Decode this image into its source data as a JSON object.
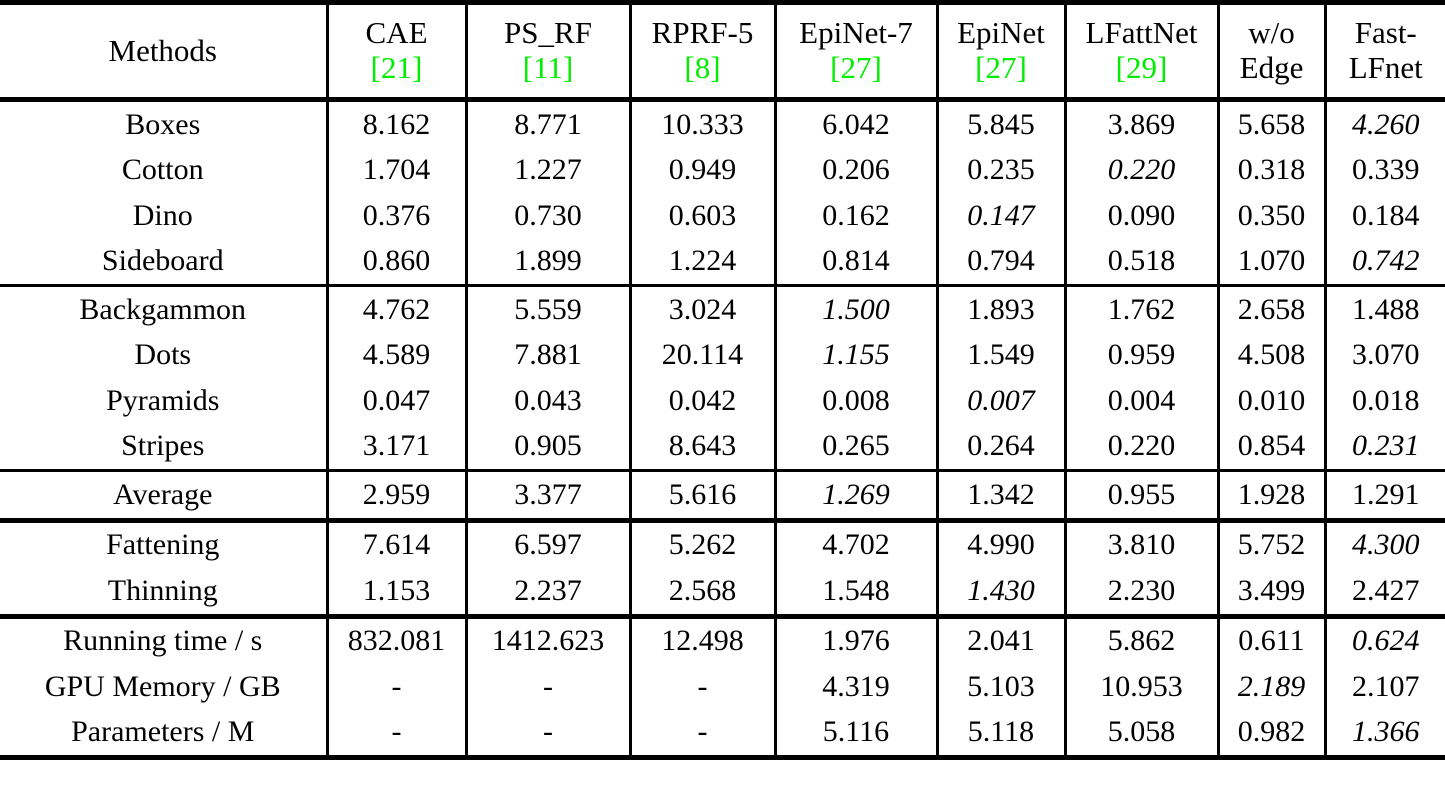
{
  "table": {
    "columns": [
      {
        "name": "Methods",
        "ref": "",
        "key": "methods"
      },
      {
        "name": "CAE",
        "ref": "21",
        "key": "cae"
      },
      {
        "name": "PS_RF",
        "ref": "11",
        "key": "psrf"
      },
      {
        "name": "RPRF-5",
        "ref": "8",
        "key": "rprf"
      },
      {
        "name": "EpiNet-7",
        "ref": "27",
        "key": "epi7"
      },
      {
        "name": "EpiNet",
        "ref": "27",
        "key": "epi"
      },
      {
        "name": "LFattNet",
        "ref": "29",
        "key": "lfatt"
      },
      {
        "name": "w/o Edge",
        "ref": "",
        "key": "woedge"
      },
      {
        "name": "Fast-LFnet",
        "ref": "",
        "key": "fast"
      }
    ],
    "header": {
      "methods": "Methods",
      "cae_name": "CAE",
      "cae_ref": "[21]",
      "psrf_name": "PS_RF",
      "psrf_ref": "[11]",
      "rprf_name": "RPRF-5",
      "rprf_ref": "[8]",
      "epi7_name": "EpiNet-7",
      "epi7_ref": "[27]",
      "epi_name": "EpiNet",
      "epi_ref": "[27]",
      "lfatt_name": "LFattNet",
      "lfatt_ref": "[29]",
      "woedge_name": "w/o",
      "woedge_ref": "Edge",
      "fast_name": "Fast-",
      "fast_ref": "LFnet"
    },
    "ref_color": "#00ee00",
    "rows": [
      {
        "label": "Boxes",
        "cae": "8.162",
        "psrf": "8.771",
        "rprf": "10.333",
        "epi7": "6.042",
        "epi": "5.845",
        "lfatt": "3.869",
        "woedge": "5.658",
        "fast": "4.260"
      },
      {
        "label": "Cotton",
        "cae": "1.704",
        "psrf": "1.227",
        "rprf": "0.949",
        "epi7": "0.206",
        "epi": "0.235",
        "lfatt": "0.220",
        "woedge": "0.318",
        "fast": "0.339"
      },
      {
        "label": "Dino",
        "cae": "0.376",
        "psrf": "0.730",
        "rprf": "0.603",
        "epi7": "0.162",
        "epi": "0.147",
        "lfatt": "0.090",
        "woedge": "0.350",
        "fast": "0.184"
      },
      {
        "label": "Sideboard",
        "cae": "0.860",
        "psrf": "1.899",
        "rprf": "1.224",
        "epi7": "0.814",
        "epi": "0.794",
        "lfatt": "0.518",
        "woedge": "1.070",
        "fast": "0.742"
      },
      {
        "label": "Backgammon",
        "cae": "4.762",
        "psrf": "5.559",
        "rprf": "3.024",
        "epi7": "1.500",
        "epi": "1.893",
        "lfatt": "1.762",
        "woedge": "2.658",
        "fast": "1.488"
      },
      {
        "label": "Dots",
        "cae": "4.589",
        "psrf": "7.881",
        "rprf": "20.114",
        "epi7": "1.155",
        "epi": "1.549",
        "lfatt": "0.959",
        "woedge": "4.508",
        "fast": "3.070"
      },
      {
        "label": "Pyramids",
        "cae": "0.047",
        "psrf": "0.043",
        "rprf": "0.042",
        "epi7": "0.008",
        "epi": "0.007",
        "lfatt": "0.004",
        "woedge": "0.010",
        "fast": "0.018"
      },
      {
        "label": "Stripes",
        "cae": "3.171",
        "psrf": "0.905",
        "rprf": "8.643",
        "epi7": "0.265",
        "epi": "0.264",
        "lfatt": "0.220",
        "woedge": "0.854",
        "fast": "0.231"
      },
      {
        "label": "Average",
        "cae": "2.959",
        "psrf": "3.377",
        "rprf": "5.616",
        "epi7": "1.269",
        "epi": "1.342",
        "lfatt": "0.955",
        "woedge": "1.928",
        "fast": "1.291"
      },
      {
        "label": "Fattening",
        "cae": "7.614",
        "psrf": "6.597",
        "rprf": "5.262",
        "epi7": "4.702",
        "epi": "4.990",
        "lfatt": "3.810",
        "woedge": "5.752",
        "fast": "4.300"
      },
      {
        "label": "Thinning",
        "cae": "1.153",
        "psrf": "2.237",
        "rprf": "2.568",
        "epi7": "1.548",
        "epi": "1.430",
        "lfatt": "2.230",
        "woedge": "3.499",
        "fast": "2.427"
      },
      {
        "label": "Running time / s",
        "cae": "832.081",
        "psrf": "1412.623",
        "rprf": "12.498",
        "epi7": "1.976",
        "epi": "2.041",
        "lfatt": "5.862",
        "woedge": "0.611",
        "fast": "0.624"
      },
      {
        "label": "GPU Memory / GB",
        "cae": "-",
        "psrf": "-",
        "rprf": "-",
        "epi7": "4.319",
        "epi": "5.103",
        "lfatt": "10.953",
        "woedge": "2.189",
        "fast": "2.107"
      },
      {
        "label": "Parameters / M",
        "cae": "-",
        "psrf": "-",
        "rprf": "-",
        "epi7": "5.116",
        "epi": "5.118",
        "lfatt": "5.058",
        "woedge": "0.982",
        "fast": "1.366"
      }
    ],
    "emphasis": {
      "bold": [
        [
          0,
          "lfatt"
        ],
        [
          1,
          "epi7"
        ],
        [
          2,
          "lfatt"
        ],
        [
          3,
          "lfatt"
        ],
        [
          4,
          "fast"
        ],
        [
          5,
          "lfatt"
        ],
        [
          6,
          "lfatt"
        ],
        [
          7,
          "lfatt"
        ],
        [
          8,
          "lfatt"
        ],
        [
          9,
          "lfatt"
        ],
        [
          10,
          "cae"
        ],
        [
          11,
          "woedge"
        ],
        [
          12,
          "fast"
        ],
        [
          13,
          "woedge"
        ]
      ],
      "italic": [
        [
          0,
          "fast"
        ],
        [
          1,
          "lfatt"
        ],
        [
          2,
          "epi"
        ],
        [
          3,
          "fast"
        ],
        [
          4,
          "epi7"
        ],
        [
          5,
          "epi7"
        ],
        [
          6,
          "epi"
        ],
        [
          7,
          "fast"
        ],
        [
          8,
          "epi7"
        ],
        [
          9,
          "fast"
        ],
        [
          10,
          "epi"
        ],
        [
          11,
          "fast"
        ],
        [
          12,
          "woedge"
        ],
        [
          13,
          "fast"
        ]
      ]
    }
  }
}
